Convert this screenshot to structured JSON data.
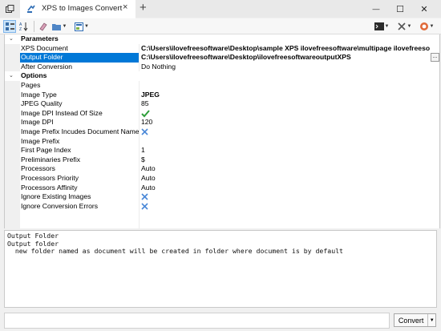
{
  "window": {
    "tab_title": "XPS to Images Convert",
    "tab_close": "×",
    "new_tab": "+",
    "minimize": "—",
    "maximize": "☐",
    "close": "✕"
  },
  "colors": {
    "selection": "#0078d7",
    "check": "#2e9e3a",
    "cross": "#4a88d8",
    "gutter": "#f0f0f0"
  },
  "grid": {
    "categories": {
      "parameters": "Parameters",
      "options": "Options"
    },
    "collapse_glyph": "⌄",
    "ellipsis": "...",
    "rows": [
      {
        "name": "XPS Document",
        "value": "C:\\Users\\ilovefreesoftware\\Desktop\\sample XPS ilovefreesoftware\\multipage ilovefreeso"
      },
      {
        "name": "Output Folder",
        "value": "C:\\Users\\ilovefreesoftware\\Desktop\\ilovefreesoftwareoutputXPS"
      },
      {
        "name": "After Conversion",
        "value": "Do Nothing"
      },
      {
        "name": "Pages",
        "value": ""
      },
      {
        "name": "Image Type",
        "value": "JPEG"
      },
      {
        "name": "JPEG Quality",
        "value": "85"
      },
      {
        "name": "Image DPI Instead Of Size",
        "value": "check"
      },
      {
        "name": "Image DPI",
        "value": "120"
      },
      {
        "name": "Image Prefix Incudes Document Name",
        "value": "cross"
      },
      {
        "name": "Image Prefix",
        "value": ""
      },
      {
        "name": "First Page Index",
        "value": "1"
      },
      {
        "name": "Preliminaries Prefix",
        "value": "$"
      },
      {
        "name": "Processors",
        "value": "Auto"
      },
      {
        "name": "Processors Priority",
        "value": "Auto"
      },
      {
        "name": "Processors Affinity",
        "value": "Auto"
      },
      {
        "name": "Ignore Existing Images",
        "value": "cross"
      },
      {
        "name": "Ignore Conversion Errors",
        "value": "cross"
      }
    ]
  },
  "description": {
    "title": "Output Folder",
    "line1": "Output folder",
    "line2": "  new folder named as document will be created in folder where document is by default"
  },
  "bottom": {
    "convert_label": "Convert",
    "drop_glyph": "▼"
  }
}
